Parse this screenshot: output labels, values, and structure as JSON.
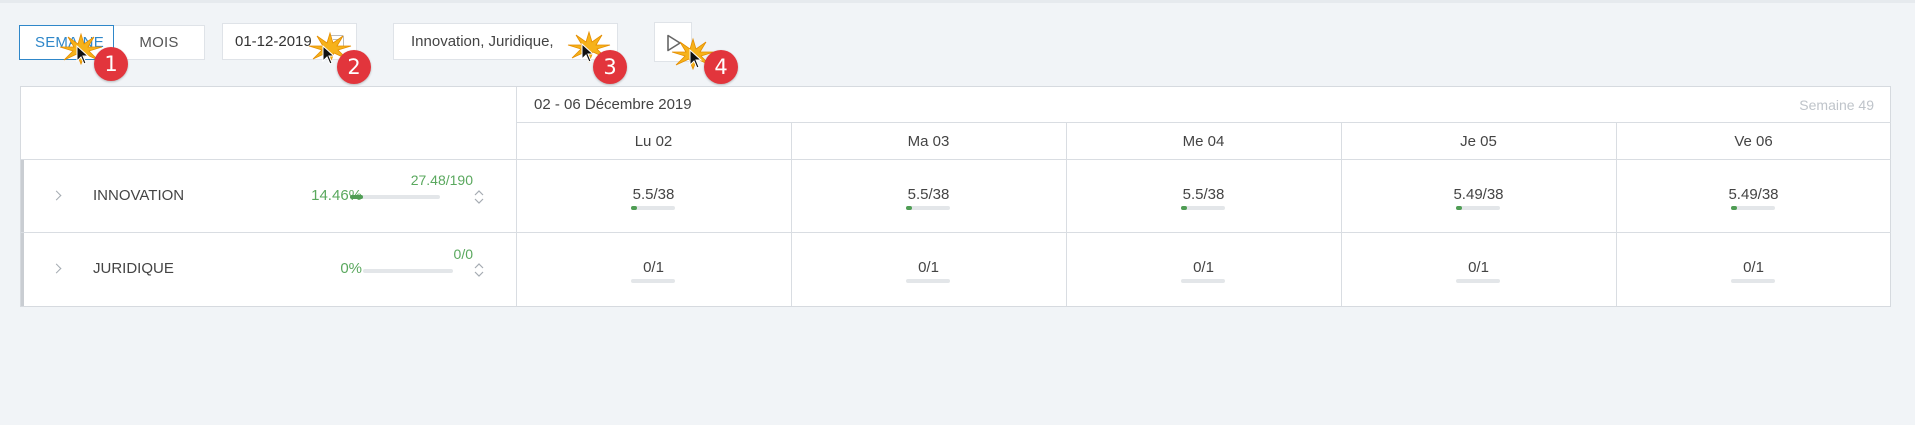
{
  "view_toggle": {
    "week_label": "SEMAINE",
    "month_label": "MOIS",
    "active": "week"
  },
  "date_field": {
    "value": "01-12-2019"
  },
  "filter_field": {
    "value": "Innovation, Juridique,"
  },
  "markers": [
    "1",
    "2",
    "3",
    "4"
  ],
  "table": {
    "week_title": "02 - 06 Décembre 2019",
    "week_number": "Semaine 49",
    "days": [
      "Lu 02",
      "Ma 03",
      "Me 04",
      "Je 05",
      "Ve 06"
    ],
    "rows": [
      {
        "name": "INNOVATION",
        "percent": "14.46%",
        "ratio": "27.48/190",
        "progress": 0.1446,
        "cells": [
          {
            "value": "5.5/38",
            "progress": 0.145
          },
          {
            "value": "5.5/38",
            "progress": 0.145
          },
          {
            "value": "5.5/38",
            "progress": 0.145
          },
          {
            "value": "5.49/38",
            "progress": 0.144
          },
          {
            "value": "5.49/38",
            "progress": 0.144
          }
        ]
      },
      {
        "name": "JURIDIQUE",
        "percent": "0%",
        "ratio": "0/0",
        "progress": 0,
        "cells": [
          {
            "value": "0/1",
            "progress": 0
          },
          {
            "value": "0/1",
            "progress": 0
          },
          {
            "value": "0/1",
            "progress": 0
          },
          {
            "value": "0/1",
            "progress": 0
          },
          {
            "value": "0/1",
            "progress": 0
          }
        ]
      }
    ]
  },
  "colors": {
    "accent": "#2f87c9",
    "positive": "#5aa85e",
    "marker": "#e2353c"
  }
}
